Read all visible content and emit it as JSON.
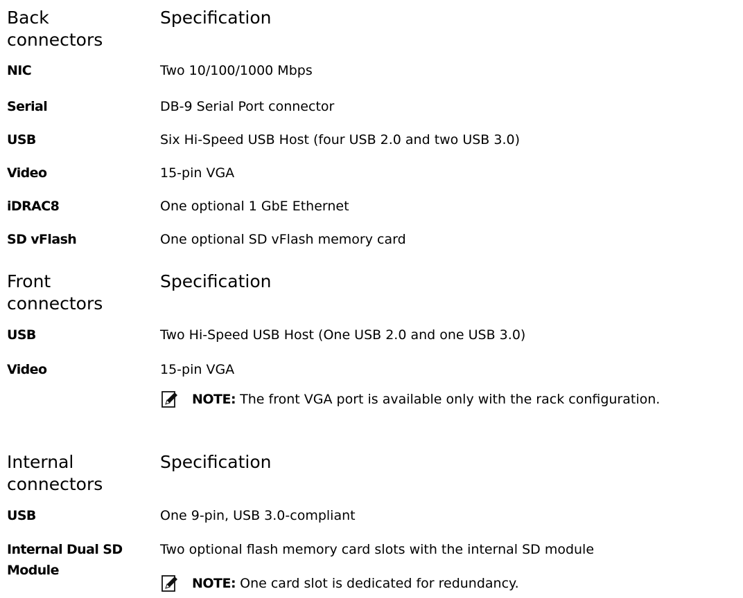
{
  "back": {
    "heading_left": "Back connectors",
    "heading_right": "Specification",
    "rows": [
      {
        "label": "NIC",
        "value": "Two 10/100/1000 Mbps"
      },
      {
        "label": "Serial",
        "value": "DB-9 Serial Port connector"
      },
      {
        "label": "USB",
        "value": "Six Hi-Speed USB Host (four USB 2.0 and two USB 3.0)"
      },
      {
        "label": "Video",
        "value": "15-pin VGA"
      },
      {
        "label": "iDRAC8",
        "value": "One optional 1 GbE Ethernet"
      },
      {
        "label": "SD vFlash",
        "value": "One optional SD vFlash memory card"
      }
    ]
  },
  "front": {
    "heading_left": "Front connectors",
    "heading_right": "Specification",
    "rows": [
      {
        "label": "USB",
        "value": "Two Hi-Speed USB Host (One USB 2.0 and one USB 3.0)"
      },
      {
        "label": "Video",
        "value": "15-pin VGA"
      }
    ],
    "note": {
      "prefix": "NOTE:",
      "text": " The front VGA port is available only with the rack configuration."
    }
  },
  "internal": {
    "heading_left": "Internal connectors",
    "heading_right": "Specification",
    "rows": [
      {
        "label": "USB",
        "value": "One 9-pin, USB 3.0-compliant"
      },
      {
        "label": "Internal Dual SD Module",
        "value": "Two optional flash memory card slots with the internal SD module"
      }
    ],
    "note": {
      "prefix": "NOTE:",
      "text": " One card slot is dedicated for redundancy."
    }
  },
  "icons": {
    "note": "pencil-note-icon"
  }
}
